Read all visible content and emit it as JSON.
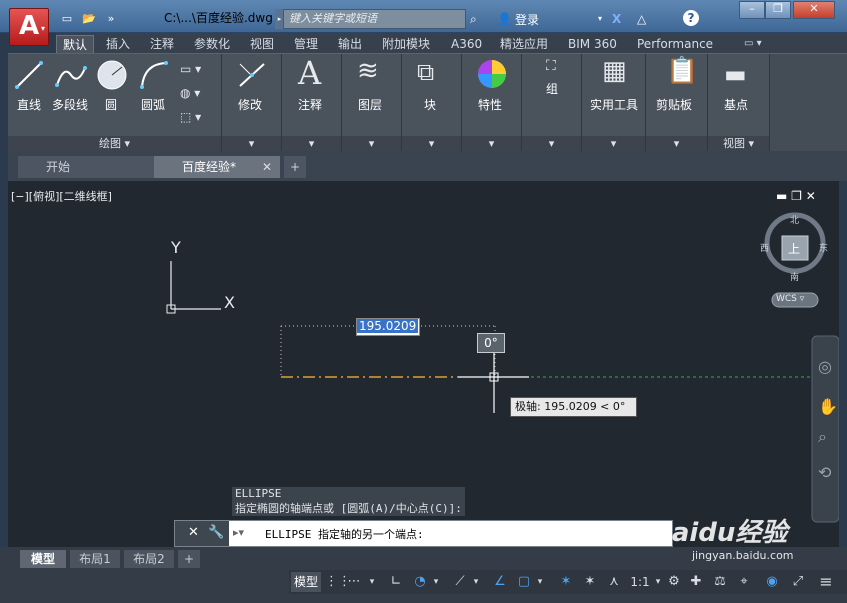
{
  "app_button": "A",
  "file_title": "C:\\...\\百度经验.dwg",
  "search_placeholder": "键入关键字或短语",
  "login_label": "登录",
  "ribbon_tabs": [
    "默认",
    "插入",
    "注释",
    "参数化",
    "视图",
    "管理",
    "输出",
    "附加模块",
    "A360",
    "精选应用",
    "BIM 360",
    "Performance"
  ],
  "panels": {
    "draw": {
      "line": "直线",
      "polyline": "多段线",
      "circle": "圆",
      "arc": "圆弧",
      "footer": "绘图 ▾"
    },
    "modify": "修改",
    "annotation": "注释",
    "layers": "图层",
    "block": "块",
    "properties": "特性",
    "group": "组",
    "utilities": "实用工具",
    "clipboard": "剪贴板",
    "view": {
      "base": "基点",
      "footer": "视图 ▾"
    }
  },
  "doc_tabs": {
    "start": "开始",
    "drawing": "百度经验*",
    "add": "+"
  },
  "viewport_label": "[−][俯视][二维线框]",
  "viewcube": {
    "north": "北",
    "south": "南",
    "east": "东",
    "west": "西",
    "top": "上",
    "wcs": "WCS ▿"
  },
  "ucs": {
    "x": "X",
    "y": "Y"
  },
  "dynamic_input": {
    "length": "195.0209",
    "angle": "0°",
    "tooltip": "极轴: 195.0209 < 0°"
  },
  "command_history": [
    "ELLIPSE",
    "指定椭圆的轴端点或 [圆弧(A)/中心点(C)]:"
  ],
  "command_line": "ELLIPSE 指定轴的另一个端点:",
  "layout_tabs": [
    "模型",
    "布局1",
    "布局2"
  ],
  "status": {
    "model": "模型",
    "scale": "1:1"
  },
  "watermark": {
    "brand": "Baidu经验",
    "url": "jingyan.baidu.com"
  }
}
